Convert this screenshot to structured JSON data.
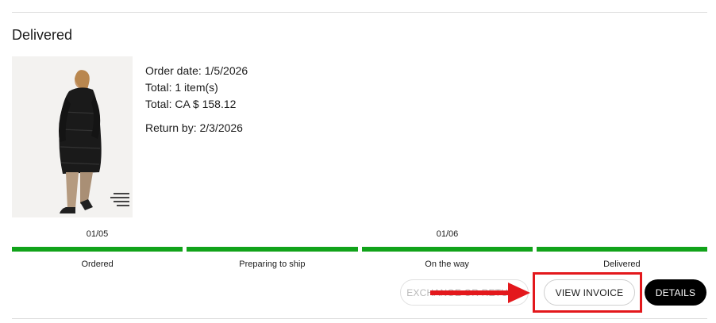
{
  "order": {
    "status": "Delivered",
    "order_date": "Order date: 1/5/2026",
    "items": "Total: 1 item(s)",
    "total": "Total: CA $ 158.12",
    "return_by": "Return by: 2/3/2026"
  },
  "tracker": {
    "dates": [
      "01/05",
      "01/06"
    ],
    "steps": [
      "Ordered",
      "Preparing to ship",
      "On the way",
      "Delivered"
    ],
    "progress": 1.0,
    "color": "#11a31a"
  },
  "actions": {
    "exchange_label": "EXCHANGE OR RETURN",
    "invoice_label": "VIEW INVOICE",
    "details_label": "DETAILS"
  },
  "annotation": {
    "color": "#e3181c",
    "icon": "arrow-right-icon"
  },
  "product_image": {
    "icon": "product-photo-long-black-puffer-coat"
  }
}
